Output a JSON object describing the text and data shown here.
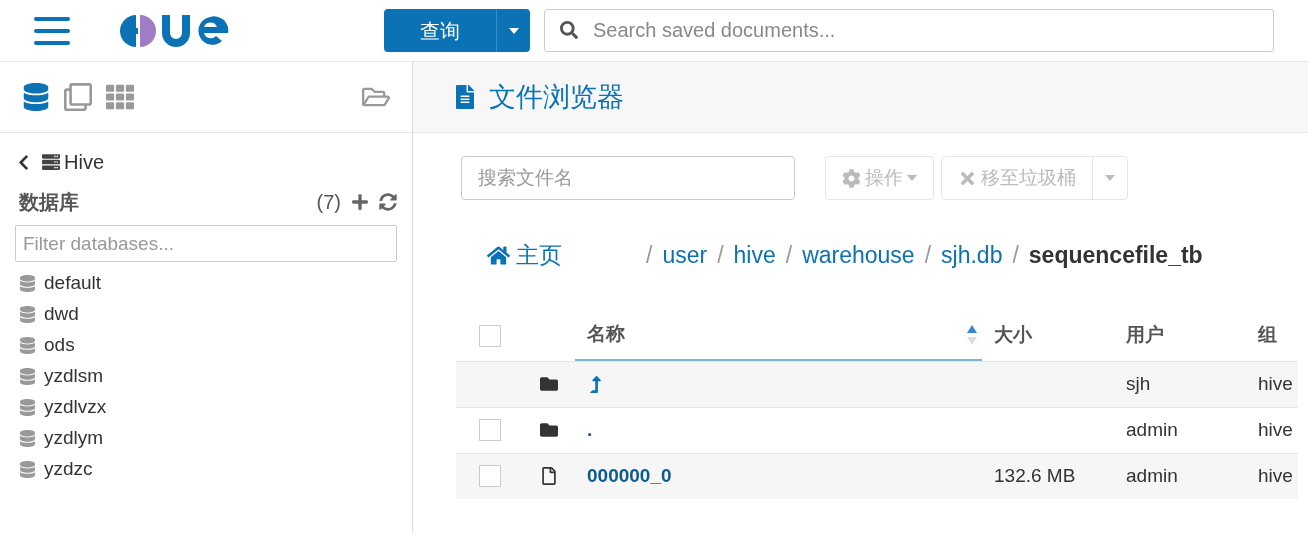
{
  "header": {
    "query_button": "查询",
    "search": {
      "placeholder": "Search saved documents..."
    }
  },
  "sidebar": {
    "tabs": [
      {
        "kind": "databases",
        "selected": true
      },
      {
        "kind": "documents",
        "selected": false
      },
      {
        "kind": "apps",
        "selected": false
      },
      {
        "kind": "files",
        "selected": false
      }
    ],
    "back_label": "Hive",
    "section_title": "数据库",
    "count": "(7)",
    "filter": {
      "placeholder": "Filter databases..."
    },
    "databases": [
      "default",
      "dwd",
      "ods",
      "yzdlsm",
      "yzdlvzx",
      "yzdlym",
      "yzdzc"
    ]
  },
  "main": {
    "title": "文件浏览器",
    "file_search": {
      "placeholder": "搜索文件名"
    },
    "actions_button": "操作",
    "trash_button": "移至垃圾桶",
    "breadcrumb": {
      "home": "主页",
      "parts": [
        {
          "separator": "/",
          "label": "user",
          "current": false
        },
        {
          "separator": "/",
          "label": "hive",
          "current": false
        },
        {
          "separator": "/",
          "label": "warehouse",
          "current": false
        },
        {
          "separator": "/",
          "label": "sjh.db",
          "current": false
        },
        {
          "separator": "/",
          "label": "sequencefile_tb",
          "current": true
        }
      ]
    },
    "table": {
      "select_all": {
        "checked": false
      },
      "columns": [
        {
          "label": "名称",
          "sorted": true
        },
        {
          "label": "大小",
          "sorted": false
        },
        {
          "label": "用户",
          "sorted": false
        },
        {
          "label": "组",
          "sorted": false
        }
      ],
      "rows": [
        {
          "kind": "parent",
          "user": "sjh",
          "group": "hive"
        },
        {
          "kind": "folder",
          "name": ".",
          "user": "admin",
          "group": "hive",
          "checked": false
        },
        {
          "kind": "file",
          "name": "000000_0",
          "size": "132.6 MB",
          "user": "admin",
          "group": "hive",
          "checked": false
        }
      ]
    }
  }
}
